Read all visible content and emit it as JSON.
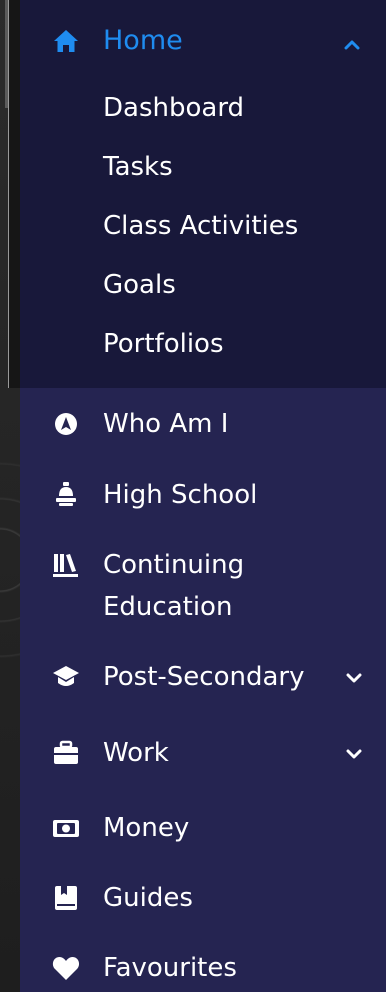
{
  "nav": {
    "home": {
      "label": "Home",
      "icon": "home-icon",
      "expanded": true,
      "accent": "#1f8cf0",
      "submenu": [
        "Dashboard",
        "Tasks",
        "Class Activities",
        "Goals",
        "Portfolios"
      ]
    },
    "items": [
      {
        "label": "Who Am I",
        "icon": "compass-icon"
      },
      {
        "label": "High School",
        "icon": "school-bell-icon"
      },
      {
        "label": "Continuing Education",
        "label_lines": [
          "Continuing",
          "Education"
        ],
        "icon": "library-icon"
      },
      {
        "label": "Post-Secondary",
        "icon": "graduation-cap-icon",
        "has_submenu": true
      },
      {
        "label": "Work",
        "icon": "briefcase-icon",
        "has_submenu": true
      },
      {
        "label": "Money",
        "icon": "money-icon"
      },
      {
        "label": "Guides",
        "icon": "guide-book-icon"
      },
      {
        "label": "Favourites",
        "icon": "heart-icon"
      }
    ]
  },
  "colors": {
    "sidebar_bg": "#252451",
    "active_group_bg": "#18183a",
    "text": "#ffffff"
  }
}
